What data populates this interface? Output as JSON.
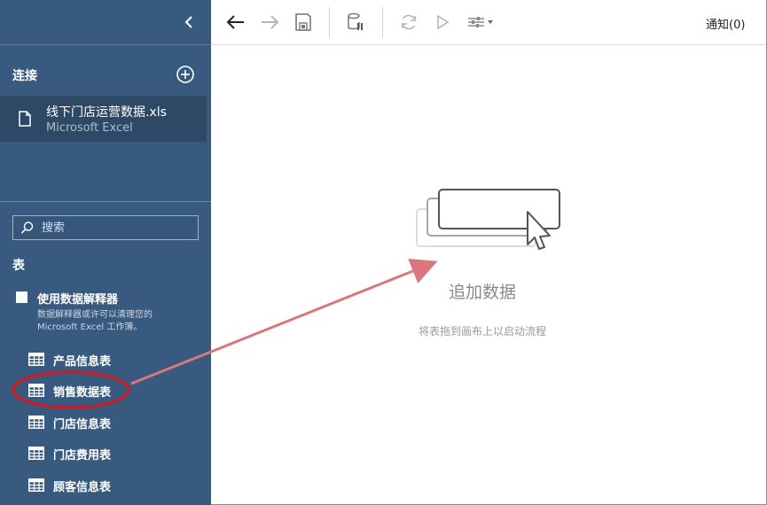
{
  "sidebar": {
    "connections_label": "连接",
    "connection": {
      "name": "线下门店运营数据.xls",
      "type": "Microsoft Excel"
    },
    "search": {
      "placeholder": "搜索"
    },
    "tables_label": "表",
    "data_interpreter": {
      "label": "使用数据解释器",
      "description": "数据解释器或许可以清理您的 Microsoft Excel 工作簿。",
      "checked": false
    },
    "tables": [
      {
        "name": "产品信息表"
      },
      {
        "name": "销售数据表",
        "highlighted": true
      },
      {
        "name": "门店信息表"
      },
      {
        "name": "门店费用表"
      },
      {
        "name": "顾客信息表"
      }
    ]
  },
  "toolbar": {
    "notifications": "通知(0)"
  },
  "canvas": {
    "add_data_title": "追加数据",
    "add_data_hint": "将表拖到画布上以启动流程"
  },
  "colors": {
    "sidebar_bg": "#385a7e",
    "selected_connection_bg": "#2d4966",
    "annotation_red": "#c0202a",
    "arrow_color": "#d9777d"
  },
  "icons": {
    "collapse": "chevron-left-icon",
    "add_connection": "plus-circle-icon",
    "connection_file": "file-icon",
    "search": "search-icon",
    "table": "table-grid-icon",
    "back": "arrow-left-icon",
    "forward": "arrow-right-icon",
    "save": "save-icon",
    "extract": "database-pause-icon",
    "refresh": "refresh-icon",
    "run": "play-icon",
    "settings": "sliders-icon"
  }
}
